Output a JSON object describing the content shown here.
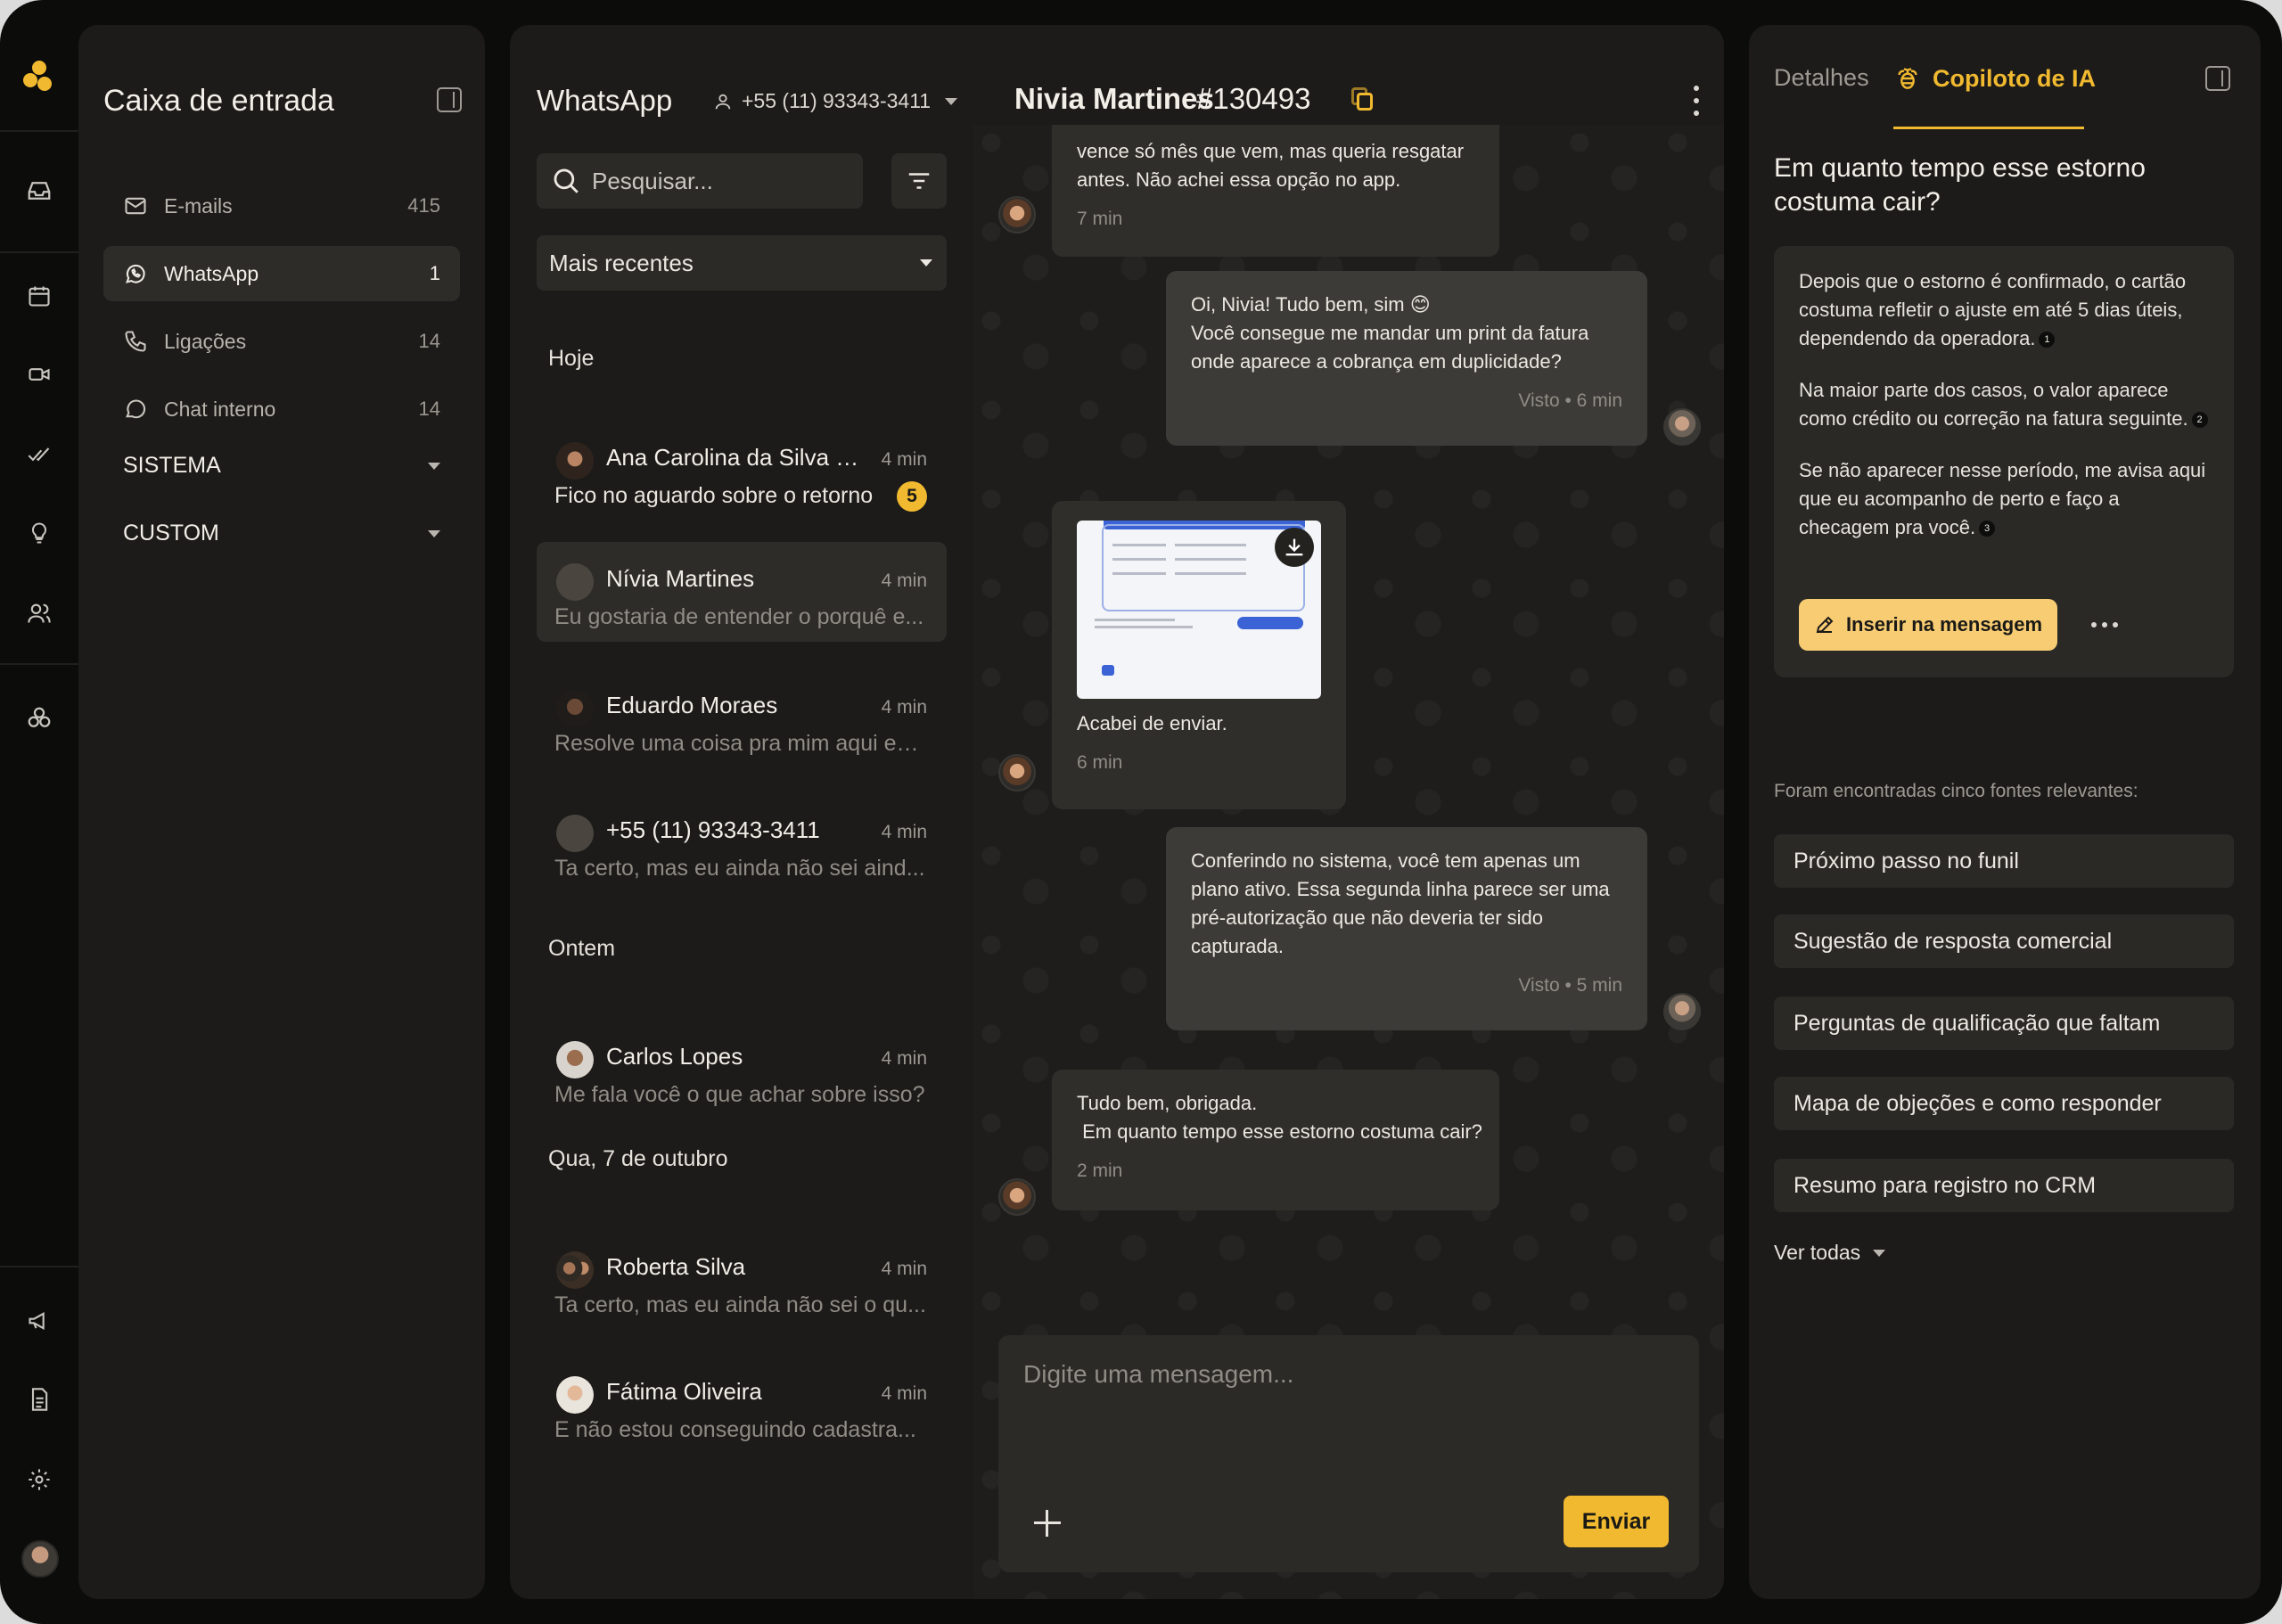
{
  "rail": {
    "icons": [
      "inbox-icon",
      "calendar-icon",
      "video-icon",
      "double-check-icon",
      "lightbulb-icon",
      "users-icon",
      "integrations-icon",
      "megaphone-icon",
      "document-icon",
      "gear-icon"
    ]
  },
  "inbox": {
    "title": "Caixa de entrada",
    "items": [
      {
        "label": "E-mails",
        "count": "415",
        "icon": "mail-icon"
      },
      {
        "label": "WhatsApp",
        "count": "1",
        "icon": "whatsapp-icon"
      },
      {
        "label": "Ligações",
        "count": "14",
        "icon": "phone-icon"
      },
      {
        "label": "Chat interno",
        "count": "14",
        "icon": "chat-bubble-icon"
      }
    ],
    "groups": [
      "SISTEMA",
      "CUSTOM"
    ]
  },
  "conversations": {
    "title": "WhatsApp",
    "phone": "+55 (11) 93343-3411",
    "search_placeholder": "Pesquisar...",
    "sort": "Mais recentes",
    "days": [
      "Hoje",
      "Ontem",
      "Qua, 7 de outubro"
    ],
    "items": [
      {
        "name": "Ana Carolina da Silva Sa...",
        "time": "4 min",
        "preview": "Fico no aguardo sobre o retorno",
        "unread": "5"
      },
      {
        "name": "Nívia Martines",
        "time": "4 min",
        "preview": "Eu gostaria de entender o porquê e..."
      },
      {
        "name": "Eduardo Moraes",
        "time": "4 min",
        "preview": "Resolve uma coisa pra mim aqui est..."
      },
      {
        "name": "+55 (11) 93343-3411",
        "time": "4 min",
        "preview": "Ta certo, mas eu ainda não sei aind..."
      },
      {
        "name": "Carlos Lopes",
        "time": "4 min",
        "preview": "Me fala você o que achar sobre isso?"
      },
      {
        "name": "Roberta Silva",
        "time": "4 min",
        "preview": "Ta certo, mas eu ainda não sei o qu..."
      },
      {
        "name": "Fátima Oliveira",
        "time": "4 min",
        "preview": "E não estou conseguindo cadastra..."
      }
    ]
  },
  "chat": {
    "contact": "Nivia Martines",
    "ticket": "#130493",
    "messages": [
      {
        "line1": "vence só mês que vem, mas queria resgatar",
        "line2": "antes. Não achei essa opção no app.",
        "meta": "7 min"
      },
      {
        "line1": "Oi, Nivia! Tudo bem, sim 😊",
        "line2": "Você consegue me mandar um print da fatura",
        "line3": "onde aparece a cobrança em duplicidade?",
        "meta": "Visto • 6 min"
      },
      {
        "text": "Acabei de enviar.",
        "meta": "6 min"
      },
      {
        "line1": "Conferindo no sistema, você tem apenas um",
        "line2": "plano ativo. Essa segunda linha parece ser uma",
        "line3": "pré-autorização que não deveria ter sido",
        "line4": "capturada.",
        "meta": "Visto • 5 min"
      },
      {
        "line1": "Tudo bem, obrigada.",
        "line2": " Em quanto tempo esse estorno costuma cair?",
        "meta": "2 min"
      }
    ],
    "composer_placeholder": "Digite uma mensagem...",
    "send_label": "Enviar"
  },
  "copilot": {
    "tab_details": "Detalhes",
    "tab_ai": "Copiloto de IA",
    "question": "Em quanto tempo esse estorno costuma cair?",
    "answer": [
      {
        "text": "Depois que o estorno é confirmado, o cartão costuma refletir o ajuste em até 5 dias úteis, dependendo da operadora.",
        "ref": "1"
      },
      {
        "text": "Na maior parte dos casos, o valor aparece como crédito ou correção na fatura seguinte.",
        "ref": "2"
      },
      {
        "text": "Se não aparecer nesse período, me avisa aqui que eu acompanho de perto e faço a checagem pra você.",
        "ref": "3"
      }
    ],
    "insert_label": "Inserir na mensagem",
    "sources_title": "Foram encontradas cinco fontes relevantes:",
    "sources": [
      "Próximo passo no funil",
      "Sugestão de resposta comercial",
      "Perguntas de qualificação que faltam",
      "Mapa de objeções e como responder",
      "Resumo para registro no CRM"
    ],
    "see_all": "Ver todas"
  },
  "colors": {
    "accent": "#f1b92f",
    "panel": "#1c1b19",
    "background": "#0c0c0b"
  }
}
